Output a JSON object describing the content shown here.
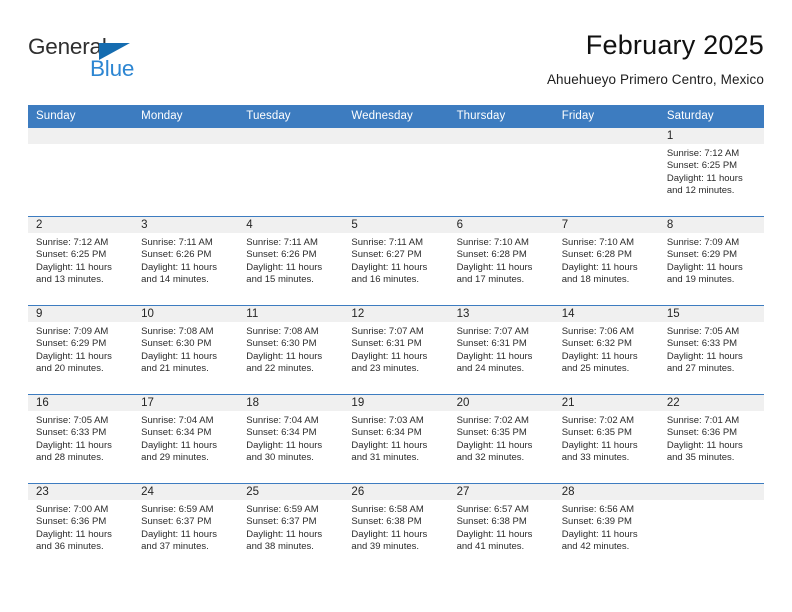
{
  "brand": {
    "name_part1": "General",
    "name_part2": "Blue",
    "logo_icon": "blue-triangle-icon",
    "color_dark": "#2f2f2f",
    "color_blue": "#2d86d2",
    "color_triangle": "#156cb0"
  },
  "header": {
    "title": "February 2025",
    "subtitle": "Ahuehueyo Primero Centro, Mexico",
    "accent_color": "#3d7cc0"
  },
  "calendar": {
    "weekday_headers": [
      "Sunday",
      "Monday",
      "Tuesday",
      "Wednesday",
      "Thursday",
      "Friday",
      "Saturday"
    ],
    "labels": {
      "sunrise": "Sunrise:",
      "sunset": "Sunset:",
      "daylight": "Daylight:"
    },
    "weeks": [
      [
        {
          "day": "",
          "sunrise": "",
          "sunset": "",
          "daylight_line1": "",
          "daylight_line2": "",
          "empty": true
        },
        {
          "day": "",
          "sunrise": "",
          "sunset": "",
          "daylight_line1": "",
          "daylight_line2": "",
          "empty": true
        },
        {
          "day": "",
          "sunrise": "",
          "sunset": "",
          "daylight_line1": "",
          "daylight_line2": "",
          "empty": true
        },
        {
          "day": "",
          "sunrise": "",
          "sunset": "",
          "daylight_line1": "",
          "daylight_line2": "",
          "empty": true
        },
        {
          "day": "",
          "sunrise": "",
          "sunset": "",
          "daylight_line1": "",
          "daylight_line2": "",
          "empty": true
        },
        {
          "day": "",
          "sunrise": "",
          "sunset": "",
          "daylight_line1": "",
          "daylight_line2": "",
          "empty": true
        },
        {
          "day": "1",
          "sunrise": "Sunrise: 7:12 AM",
          "sunset": "Sunset: 6:25 PM",
          "daylight_line1": "Daylight: 11 hours",
          "daylight_line2": "and 12 minutes.",
          "empty": false
        }
      ],
      [
        {
          "day": "2",
          "sunrise": "Sunrise: 7:12 AM",
          "sunset": "Sunset: 6:25 PM",
          "daylight_line1": "Daylight: 11 hours",
          "daylight_line2": "and 13 minutes.",
          "empty": false
        },
        {
          "day": "3",
          "sunrise": "Sunrise: 7:11 AM",
          "sunset": "Sunset: 6:26 PM",
          "daylight_line1": "Daylight: 11 hours",
          "daylight_line2": "and 14 minutes.",
          "empty": false
        },
        {
          "day": "4",
          "sunrise": "Sunrise: 7:11 AM",
          "sunset": "Sunset: 6:26 PM",
          "daylight_line1": "Daylight: 11 hours",
          "daylight_line2": "and 15 minutes.",
          "empty": false
        },
        {
          "day": "5",
          "sunrise": "Sunrise: 7:11 AM",
          "sunset": "Sunset: 6:27 PM",
          "daylight_line1": "Daylight: 11 hours",
          "daylight_line2": "and 16 minutes.",
          "empty": false
        },
        {
          "day": "6",
          "sunrise": "Sunrise: 7:10 AM",
          "sunset": "Sunset: 6:28 PM",
          "daylight_line1": "Daylight: 11 hours",
          "daylight_line2": "and 17 minutes.",
          "empty": false
        },
        {
          "day": "7",
          "sunrise": "Sunrise: 7:10 AM",
          "sunset": "Sunset: 6:28 PM",
          "daylight_line1": "Daylight: 11 hours",
          "daylight_line2": "and 18 minutes.",
          "empty": false
        },
        {
          "day": "8",
          "sunrise": "Sunrise: 7:09 AM",
          "sunset": "Sunset: 6:29 PM",
          "daylight_line1": "Daylight: 11 hours",
          "daylight_line2": "and 19 minutes.",
          "empty": false
        }
      ],
      [
        {
          "day": "9",
          "sunrise": "Sunrise: 7:09 AM",
          "sunset": "Sunset: 6:29 PM",
          "daylight_line1": "Daylight: 11 hours",
          "daylight_line2": "and 20 minutes.",
          "empty": false
        },
        {
          "day": "10",
          "sunrise": "Sunrise: 7:08 AM",
          "sunset": "Sunset: 6:30 PM",
          "daylight_line1": "Daylight: 11 hours",
          "daylight_line2": "and 21 minutes.",
          "empty": false
        },
        {
          "day": "11",
          "sunrise": "Sunrise: 7:08 AM",
          "sunset": "Sunset: 6:30 PM",
          "daylight_line1": "Daylight: 11 hours",
          "daylight_line2": "and 22 minutes.",
          "empty": false
        },
        {
          "day": "12",
          "sunrise": "Sunrise: 7:07 AM",
          "sunset": "Sunset: 6:31 PM",
          "daylight_line1": "Daylight: 11 hours",
          "daylight_line2": "and 23 minutes.",
          "empty": false
        },
        {
          "day": "13",
          "sunrise": "Sunrise: 7:07 AM",
          "sunset": "Sunset: 6:31 PM",
          "daylight_line1": "Daylight: 11 hours",
          "daylight_line2": "and 24 minutes.",
          "empty": false
        },
        {
          "day": "14",
          "sunrise": "Sunrise: 7:06 AM",
          "sunset": "Sunset: 6:32 PM",
          "daylight_line1": "Daylight: 11 hours",
          "daylight_line2": "and 25 minutes.",
          "empty": false
        },
        {
          "day": "15",
          "sunrise": "Sunrise: 7:05 AM",
          "sunset": "Sunset: 6:33 PM",
          "daylight_line1": "Daylight: 11 hours",
          "daylight_line2": "and 27 minutes.",
          "empty": false
        }
      ],
      [
        {
          "day": "16",
          "sunrise": "Sunrise: 7:05 AM",
          "sunset": "Sunset: 6:33 PM",
          "daylight_line1": "Daylight: 11 hours",
          "daylight_line2": "and 28 minutes.",
          "empty": false
        },
        {
          "day": "17",
          "sunrise": "Sunrise: 7:04 AM",
          "sunset": "Sunset: 6:34 PM",
          "daylight_line1": "Daylight: 11 hours",
          "daylight_line2": "and 29 minutes.",
          "empty": false
        },
        {
          "day": "18",
          "sunrise": "Sunrise: 7:04 AM",
          "sunset": "Sunset: 6:34 PM",
          "daylight_line1": "Daylight: 11 hours",
          "daylight_line2": "and 30 minutes.",
          "empty": false
        },
        {
          "day": "19",
          "sunrise": "Sunrise: 7:03 AM",
          "sunset": "Sunset: 6:34 PM",
          "daylight_line1": "Daylight: 11 hours",
          "daylight_line2": "and 31 minutes.",
          "empty": false
        },
        {
          "day": "20",
          "sunrise": "Sunrise: 7:02 AM",
          "sunset": "Sunset: 6:35 PM",
          "daylight_line1": "Daylight: 11 hours",
          "daylight_line2": "and 32 minutes.",
          "empty": false
        },
        {
          "day": "21",
          "sunrise": "Sunrise: 7:02 AM",
          "sunset": "Sunset: 6:35 PM",
          "daylight_line1": "Daylight: 11 hours",
          "daylight_line2": "and 33 minutes.",
          "empty": false
        },
        {
          "day": "22",
          "sunrise": "Sunrise: 7:01 AM",
          "sunset": "Sunset: 6:36 PM",
          "daylight_line1": "Daylight: 11 hours",
          "daylight_line2": "and 35 minutes.",
          "empty": false
        }
      ],
      [
        {
          "day": "23",
          "sunrise": "Sunrise: 7:00 AM",
          "sunset": "Sunset: 6:36 PM",
          "daylight_line1": "Daylight: 11 hours",
          "daylight_line2": "and 36 minutes.",
          "empty": false
        },
        {
          "day": "24",
          "sunrise": "Sunrise: 6:59 AM",
          "sunset": "Sunset: 6:37 PM",
          "daylight_line1": "Daylight: 11 hours",
          "daylight_line2": "and 37 minutes.",
          "empty": false
        },
        {
          "day": "25",
          "sunrise": "Sunrise: 6:59 AM",
          "sunset": "Sunset: 6:37 PM",
          "daylight_line1": "Daylight: 11 hours",
          "daylight_line2": "and 38 minutes.",
          "empty": false
        },
        {
          "day": "26",
          "sunrise": "Sunrise: 6:58 AM",
          "sunset": "Sunset: 6:38 PM",
          "daylight_line1": "Daylight: 11 hours",
          "daylight_line2": "and 39 minutes.",
          "empty": false
        },
        {
          "day": "27",
          "sunrise": "Sunrise: 6:57 AM",
          "sunset": "Sunset: 6:38 PM",
          "daylight_line1": "Daylight: 11 hours",
          "daylight_line2": "and 41 minutes.",
          "empty": false
        },
        {
          "day": "28",
          "sunrise": "Sunrise: 6:56 AM",
          "sunset": "Sunset: 6:39 PM",
          "daylight_line1": "Daylight: 11 hours",
          "daylight_line2": "and 42 minutes.",
          "empty": false
        },
        {
          "day": "",
          "sunrise": "",
          "sunset": "",
          "daylight_line1": "",
          "daylight_line2": "",
          "empty": true
        }
      ]
    ]
  }
}
